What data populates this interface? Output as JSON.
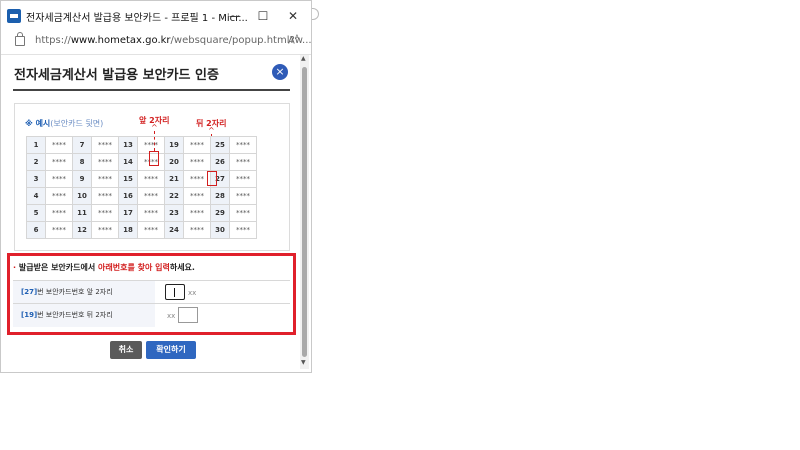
{
  "window": {
    "title": "전자세금계산서 발급용 보안카드 - 프로필 1 - Micr...",
    "minimize": "—",
    "maximize": "☐",
    "close": "✕"
  },
  "address": {
    "scheme": "https://",
    "host": "www.hometax.go.kr",
    "path": "/websquare/popup.html?w...",
    "read_aloud": "A̅"
  },
  "popup": {
    "title": "전자세금계산서 발급용 보안카드 인증",
    "close": "×",
    "example_label": "※ 예시",
    "example_sub": "(보안카드 뒷면)",
    "ann_front": "앞 2자리",
    "ann_back": "뒤 2자리",
    "card_rows": [
      [
        "1",
        "****",
        "7",
        "****",
        "13",
        "****",
        "19",
        "****",
        "25",
        "****"
      ],
      [
        "2",
        "****",
        "8",
        "****",
        "14",
        "****",
        "20",
        "****",
        "26",
        "****"
      ],
      [
        "3",
        "****",
        "9",
        "****",
        "15",
        "****",
        "21",
        "****",
        "27",
        "****"
      ],
      [
        "4",
        "****",
        "10",
        "****",
        "16",
        "****",
        "22",
        "****",
        "28",
        "****"
      ],
      [
        "5",
        "****",
        "11",
        "****",
        "17",
        "****",
        "23",
        "****",
        "29",
        "****"
      ],
      [
        "6",
        "****",
        "12",
        "****",
        "18",
        "****",
        "24",
        "****",
        "30",
        "****"
      ]
    ],
    "instruction_prefix": "발급받은 보안카드에서 ",
    "instruction_red": "아래번호를 찾아 입력",
    "instruction_suffix": "하세요.",
    "bullet": "·",
    "field1_num": "[27]",
    "field1_label": "번 보안카드번호 앞 2자리",
    "field1_mask": "xx",
    "field2_num": "[19]",
    "field2_label": "번 보안카드번호 뒤 2자리",
    "field2_mask": "xx",
    "cancel": "취소",
    "confirm": "확인하기"
  }
}
